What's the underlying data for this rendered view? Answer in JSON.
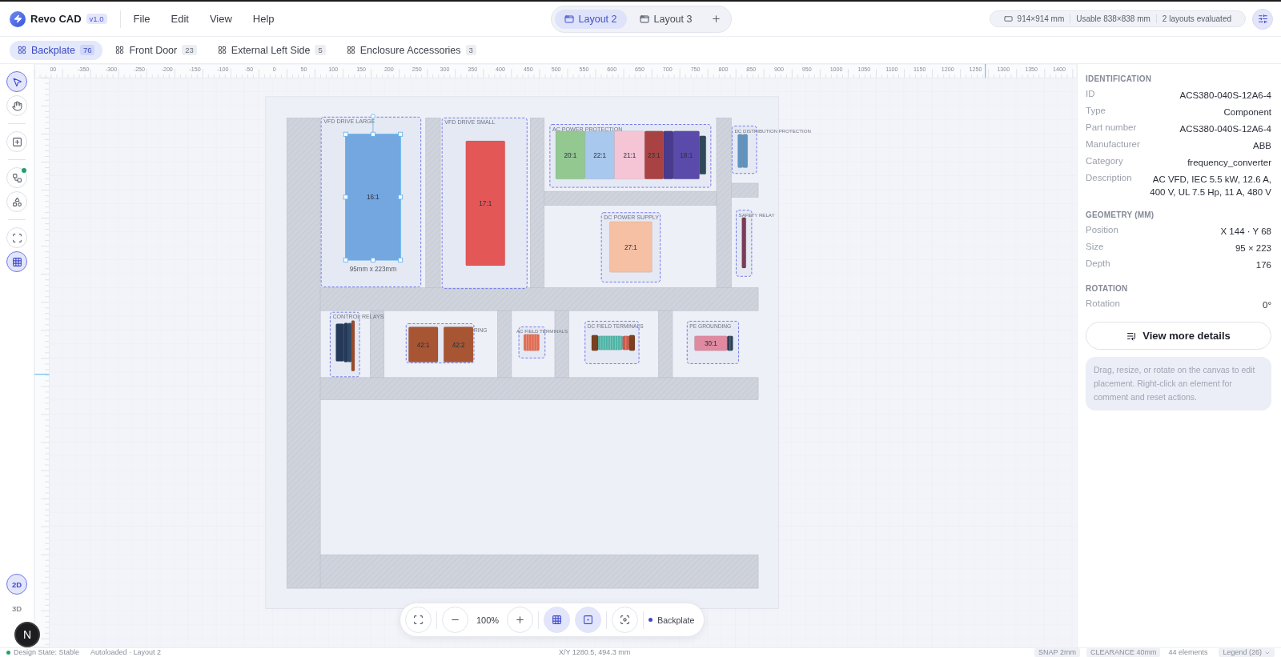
{
  "app": {
    "name": "Revo CAD",
    "version": "v1.0"
  },
  "menu": [
    "File",
    "Edit",
    "View",
    "Help"
  ],
  "layouts": [
    {
      "label": "Layout 2",
      "selected": true
    },
    {
      "label": "Layout 3",
      "selected": false
    }
  ],
  "info": {
    "size": "914×914 mm",
    "usable": "Usable 838×838 mm",
    "evaluated": "2 layouts evaluated"
  },
  "views": [
    {
      "label": "Backplate",
      "count": "76",
      "selected": true
    },
    {
      "label": "Front Door",
      "count": "23",
      "selected": false
    },
    {
      "label": "External Left Side",
      "count": "5",
      "selected": false
    },
    {
      "label": "Enclosure Accessories",
      "count": "3",
      "selected": false
    }
  ],
  "tool_groups": [
    [
      {
        "kind": "select",
        "selected": true,
        "notification": false
      },
      {
        "kind": "pan",
        "selected": false,
        "notification": false
      }
    ],
    [
      {
        "kind": "add",
        "selected": false,
        "notification": false
      }
    ],
    [
      {
        "kind": "graph",
        "selected": false,
        "notification": true
      },
      {
        "kind": "parts",
        "selected": false,
        "notification": false
      }
    ],
    [
      {
        "kind": "fit",
        "selected": false,
        "notification": false
      },
      {
        "kind": "grid",
        "selected": true,
        "notification": false
      }
    ]
  ],
  "view_modes": [
    {
      "label": "2D",
      "selected": true
    },
    {
      "label": "3D",
      "selected": false
    }
  ],
  "dev_badge": "N",
  "ruler": {
    "labels": [
      "00",
      "-350",
      "-300",
      "-250",
      "-200",
      "-150",
      "-100",
      "-50",
      "0",
      "50",
      "100",
      "150",
      "200",
      "250",
      "300",
      "350",
      "400",
      "450",
      "500",
      "550",
      "600",
      "650",
      "700",
      "750",
      "800",
      "850",
      "900",
      "950",
      "1000",
      "1050",
      "1100",
      "1150",
      "1200",
      "1250",
      "1300",
      "1350",
      "1400"
    ]
  },
  "canvas": {
    "groups": [
      {
        "label": "VFD DRIVE LARGE"
      },
      {
        "label": "VFD DRIVE SMALL"
      },
      {
        "label": "AC POWER PROTECTION"
      },
      {
        "label": "DC DISTRIBUTION PROTECTION"
      },
      {
        "label": "DC POWER SUPPLY"
      },
      {
        "label": "SAFETY RELAY"
      },
      {
        "label": "CONTROL RELAYS"
      },
      {
        "label": "RING"
      },
      {
        "label": "AC FIELD TERMINALS"
      },
      {
        "label": "DC FIELD TERMINALS"
      },
      {
        "label": "PE GROUNDING"
      }
    ],
    "components": [
      {
        "label": "16:1",
        "color": "#74a7e0",
        "kind": "block",
        "selected": true
      },
      {
        "label": "17:1",
        "color": "#e35757",
        "kind": "block",
        "selected": false
      },
      {
        "label": "20:1",
        "color": "#93c990",
        "kind": "block",
        "selected": false
      },
      {
        "label": "22:1",
        "color": "#a8c8ee",
        "kind": "block",
        "selected": false
      },
      {
        "label": "21:1",
        "color": "#f5c5d6",
        "kind": "block",
        "selected": false
      },
      {
        "label": "23:1",
        "color": "#a94343",
        "kind": "block",
        "selected": false
      },
      {
        "color": "#483a8c",
        "kind": "block",
        "selected": false
      },
      {
        "label": "18:1",
        "color": "#5a4aaa",
        "kind": "block",
        "selected": false
      },
      {
        "color": "#2f4858",
        "kind": "block",
        "selected": false
      },
      {
        "color": "#5f93c0",
        "kind": "block",
        "selected": false
      },
      {
        "color": "#5f93c0",
        "kind": "block",
        "selected": false
      },
      {
        "label": "27:1",
        "color": "#f5c0a4",
        "kind": "block",
        "selected": false
      },
      {
        "color": "#7b3b58",
        "kind": "block",
        "selected": false
      },
      {
        "color": "#253a5a",
        "kind": "block",
        "selected": false
      },
      {
        "color": "#253a5a",
        "kind": "block",
        "selected": false
      },
      {
        "color": "#2e4a66",
        "kind": "block",
        "selected": false
      },
      {
        "color": "#9a4a2a",
        "kind": "block",
        "selected": false
      },
      {
        "label": "42:1",
        "color": "#a85533",
        "kind": "block",
        "selected": false
      },
      {
        "label": "42:2",
        "color": "#a85533",
        "kind": "block",
        "selected": false
      },
      {
        "color": "#e06a50",
        "kind": "strip",
        "selected": false
      },
      {
        "color": "#7a4020",
        "kind": "block",
        "selected": false
      },
      {
        "color": "#4db3a5",
        "kind": "strip",
        "selected": false
      },
      {
        "color": "#d05a4a",
        "kind": "strip",
        "selected": false
      },
      {
        "color": "#7a4020",
        "kind": "block",
        "selected": false
      },
      {
        "label": "30:1",
        "color": "#e08aa2",
        "kind": "block",
        "selected": false
      },
      {
        "color": "#2a4055",
        "kind": "strip",
        "selected": false
      }
    ],
    "dimension": "95mm x 223mm"
  },
  "zoom_bar": {
    "zoom": "100%",
    "grid_on": true,
    "snap_on": true,
    "layer": "Backplate"
  },
  "inspector": {
    "sections": [
      {
        "title": "IDENTIFICATION",
        "rows": [
          {
            "label": "ID",
            "value": "ACS380-040S-12A6-4"
          },
          {
            "label": "Type",
            "value": "Component"
          },
          {
            "label": "Part number",
            "value": "ACS380-040S-12A6-4"
          },
          {
            "label": "Manufacturer",
            "value": "ABB"
          },
          {
            "label": "Category",
            "value": "frequency_converter"
          },
          {
            "label": "Description",
            "value": "AC VFD, IEC 5.5 kW, 12.6 A, 400 V, UL 7.5 Hp, 11 A, 480 V"
          }
        ]
      },
      {
        "title": "GEOMETRY (MM)",
        "rows": [
          {
            "label": "Position",
            "value": "X 144 · Y 68"
          },
          {
            "label": "Size",
            "value": "95 × 223"
          },
          {
            "label": "Depth",
            "value": "176"
          }
        ]
      },
      {
        "title": "ROTATION",
        "rows": [
          {
            "label": "Rotation",
            "value": "0°"
          }
        ]
      }
    ],
    "details_button": "View more details",
    "hint": "Drag, resize, or rotate on the canvas to edit placement. Right-click an element for comment and reset actions."
  },
  "status": {
    "state": "Design State: Stable",
    "autoload": "Autoloaded · Layout 2",
    "cursor": "X/Y 1280.5, 494.3 mm",
    "chips": [
      "SNAP 2mm",
      "CLEARANCE 40mm"
    ],
    "elements": "44 elements",
    "legend": "Legend (26)"
  }
}
